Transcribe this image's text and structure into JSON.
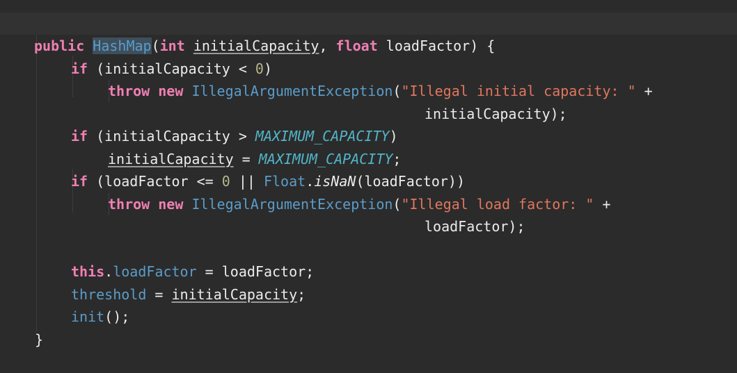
{
  "code": {
    "lines": {
      "l0": {
        "comment": "*/"
      },
      "l1": {
        "t1": "public",
        "t2": "HashMap",
        "t3": "(",
        "t4": "int",
        "t5": "initialCapacity",
        "t6": ", ",
        "t7": "float",
        "t8": " loadFactor) {"
      },
      "l2": {
        "t1": "if",
        "t2": " (initialCapacity < ",
        "t3": "0",
        "t4": ")"
      },
      "l3": {
        "t1": "throw",
        "t2": "new",
        "t3": "IllegalArgumentException",
        "t4": "(",
        "t5": "\"Illegal initial capacity: \"",
        "t6": " +"
      },
      "l4": {
        "t1": "initialCapacity);"
      },
      "l5": {
        "t1": "if",
        "t2": " (initialCapacity > ",
        "t3": "MAXIMUM_CAPACITY",
        "t4": ")"
      },
      "l6": {
        "t1": "initialCapacity",
        "t2": " = ",
        "t3": "MAXIMUM_CAPACITY",
        "t4": ";"
      },
      "l7": {
        "t1": "if",
        "t2": " (loadFactor <= ",
        "t3": "0",
        "t4": " || ",
        "t5": "Float",
        "t6": ".",
        "t7": "isNaN",
        "t8": "(loadFactor))"
      },
      "l8": {
        "t1": "throw",
        "t2": "new",
        "t3": "IllegalArgumentException",
        "t4": "(",
        "t5": "\"Illegal load factor: \"",
        "t6": " +"
      },
      "l9": {
        "t1": "loadFactor);"
      },
      "l11": {
        "t1": "this",
        "t2": ".",
        "t3": "loadFactor",
        "t4": " = loadFactor;"
      },
      "l12": {
        "t1": "threshold",
        "t2": " = ",
        "t3": "initialCapacity",
        "t4": ";"
      },
      "l13": {
        "t1": "init",
        "t2": "();"
      },
      "l14": {
        "t1": "}"
      }
    }
  },
  "colors": {
    "background": "#2b2b2b",
    "current_line": "#323232",
    "keyword": "#f07fb3",
    "class_name": "#5b9cc9",
    "constant": "#52b5c8",
    "number": "#b5b68b",
    "string": "#e1765e",
    "text": "#ececec"
  }
}
